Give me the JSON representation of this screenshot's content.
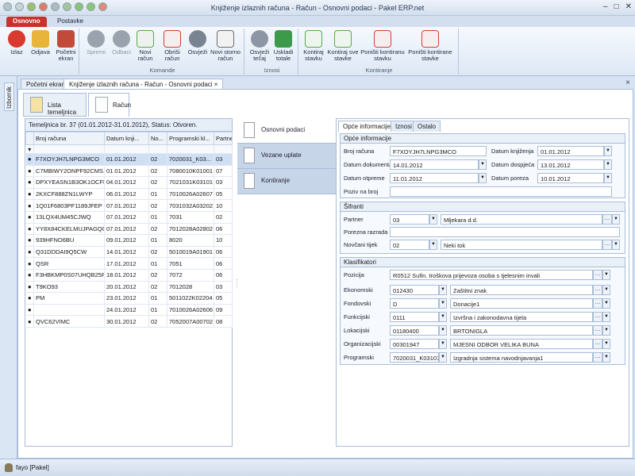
{
  "window": {
    "title": "Knjiženje izlaznih računa - Račun - Osnovni podaci - Pakel ERP.net"
  },
  "ribbon_tabs": [
    "Osnovno",
    "Postavke"
  ],
  "ribbon": {
    "buttons": [
      {
        "label": "Izlaz",
        "icon": "power-icon",
        "color": "#d93a2f",
        "enabled": true
      },
      {
        "label": "Odjava",
        "icon": "lock-icon",
        "color": "#e8b43a",
        "enabled": true
      },
      {
        "label": "Početni ekran",
        "icon": "home-icon",
        "color": "#c24a3a",
        "enabled": true
      },
      {
        "label": "Spremi",
        "icon": "check-icon",
        "color": "#9aa3ad",
        "enabled": false
      },
      {
        "label": "Odbaci",
        "icon": "cancel-icon",
        "color": "#9aa3ad",
        "enabled": false
      },
      {
        "label": "Novi račun",
        "icon": "new-document-icon",
        "color": "#5aa84a",
        "enabled": true
      },
      {
        "label": "Obriši račun",
        "icon": "delete-document-icon",
        "color": "#d0413a",
        "enabled": true
      },
      {
        "label": "Osvježi",
        "icon": "refresh-icon",
        "color": "#7a8490",
        "enabled": true
      },
      {
        "label": "Novi storno račun",
        "icon": "storno-document-icon",
        "color": "#6d6d6d",
        "enabled": true
      },
      {
        "label": "Osvježi tečaj",
        "icon": "gear-icon",
        "color": "#8c96a4",
        "enabled": true
      },
      {
        "label": "Uskladi totale",
        "icon": "calculator-icon",
        "color": "#3d9a4a",
        "enabled": true
      },
      {
        "label": "Kontiraj stavku",
        "icon": "add-entry-icon",
        "color": "#5aa84a",
        "enabled": true
      },
      {
        "label": "Kontiraj sve stavke",
        "icon": "add-all-icon",
        "color": "#5aa84a",
        "enabled": true
      },
      {
        "label": "Poništi kontiranu stavku",
        "icon": "cancel-entry-icon",
        "color": "#d0413a",
        "enabled": true
      },
      {
        "label": "Poništi kontirane stavke",
        "icon": "cancel-all-icon",
        "color": "#d0413a",
        "enabled": true
      }
    ],
    "groups": [
      "Komande",
      "Iznosi",
      "Kontiranje"
    ]
  },
  "sidebar": {
    "label": "Izbornik"
  },
  "doc_tabs": [
    "Početni ekran",
    "Knjiženje izlaznih računa - Račun - Osnovni podaci"
  ],
  "work_tabs": [
    "Lista temeljnica",
    "Račun"
  ],
  "left_panel": {
    "header": "Temeljnica br. 37 (01.01.2012-31.01.2012), Status: Otvoren.",
    "columns": [
      "Broj računa",
      "Datum knji...",
      "No...",
      "Programski kl...",
      "Partne"
    ],
    "rows": [
      [
        "F7XOYJH7LNPG3MCO",
        "01.01.2012",
        "02",
        "7020031_K03...",
        "03"
      ],
      [
        "C7MBIWY2ONPF92CMS...",
        "01.01.2012",
        "02",
        "7080010K01001",
        "07"
      ],
      [
        "DPXYEASN1B3OK1OCFH",
        "04.01.2012",
        "02",
        "7021031K03101",
        "03"
      ],
      [
        "2KXCF888ZN1LWYP",
        "06.01.2012",
        "01",
        "7010026A02607",
        "05"
      ],
      [
        "1Q01F6803PF1189JFEP",
        "07.01.2012",
        "02",
        "7031032A03202",
        "10"
      ],
      [
        "13LQX4UM45CJWQ",
        "07.01.2012",
        "01",
        "7031",
        "02"
      ],
      [
        "YY8X84CKELMUJPAGQO...",
        "07.01.2012",
        "02",
        "7012028A02802",
        "06"
      ],
      [
        "939HFNO6BU",
        "09.01.2012",
        "01",
        "8020",
        "10"
      ],
      [
        "Q31DDDAI9Q5CW",
        "14.01.2012",
        "02",
        "5010019A01901",
        "06"
      ],
      [
        "QSR",
        "17.01.2012",
        "01",
        "7051",
        "06"
      ],
      [
        "F3HBKMP0S07UHQB25P...",
        "18.01.2012",
        "02",
        "7072",
        "06"
      ],
      [
        "T9KO93",
        "20.01.2012",
        "02",
        "7012028",
        "03"
      ],
      [
        "PM",
        "23.01.2012",
        "01",
        "5011022K02204",
        "05"
      ],
      [
        "",
        "24.01.2012",
        "01",
        "7010026A02606",
        "09"
      ],
      [
        "QVC62VIMC",
        "30.01.2012",
        "02",
        "7052007A00702",
        "08"
      ]
    ]
  },
  "nav": [
    "Osnovni podaci",
    "Vezane uplate",
    "Kontiranje"
  ],
  "inner_tabs": [
    "Opće informacije",
    "Iznosi",
    "Ostalo"
  ],
  "opce": {
    "title": "Opće informacije",
    "broj_racuna_label": "Broj računa",
    "broj_racuna": "F7XOYJH7LNPG3MCO",
    "datum_knjizenja_label": "Datum knjiženja",
    "datum_knjizenja": "01.01.2012",
    "datum_dokumenta_label": "Datum dokumenta",
    "datum_dokumenta": "14.01.2012",
    "datum_dospijeca_label": "Datum dospjeća",
    "datum_dospijeca": "13.01.2012",
    "datum_otpreme_label": "Datum otpreme",
    "datum_otpreme": "11.01.2012",
    "datum_poreza_label": "Datum poreza",
    "datum_poreza": "10.01.2012",
    "poziv_label": "Poziv na broj",
    "poziv": ""
  },
  "sifranti": {
    "title": "Šifranti",
    "partner_label": "Partner",
    "partner_code": "03",
    "partner_name": "Mljekara d.d.",
    "porezna_label": "Porezna razrada",
    "porezna": "",
    "novcani_label": "Novčani tijek",
    "novcani_code": "02",
    "novcani_name": "Neki tok"
  },
  "klasifikatori": {
    "title": "Klasifikatori",
    "pozicija_label": "Pozicija",
    "pozicija": "R0512 Sufin. troškova prijevoza osoba s tjelesnim invali",
    "rows": [
      {
        "label": "Ekonomski",
        "code": "012430",
        "name": "Zaštitni znak"
      },
      {
        "label": "Fondovski",
        "code": "D",
        "name": "Donacije1"
      },
      {
        "label": "Funkcijski",
        "code": "0111",
        "name": "Izvršna i zakonodavna tijela"
      },
      {
        "label": "Lokacijski",
        "code": "01180400",
        "name": "BRTONIGLA"
      },
      {
        "label": "Organizacijski",
        "code": "00301947",
        "name": "MJESNI ODBOR VELIKA BUNA"
      },
      {
        "label": "Programski",
        "code": "7020031_K03107",
        "name": "Izgradnja sistema navodnjavanja1"
      }
    ]
  },
  "status": {
    "user": "fayo [Pakel]"
  }
}
